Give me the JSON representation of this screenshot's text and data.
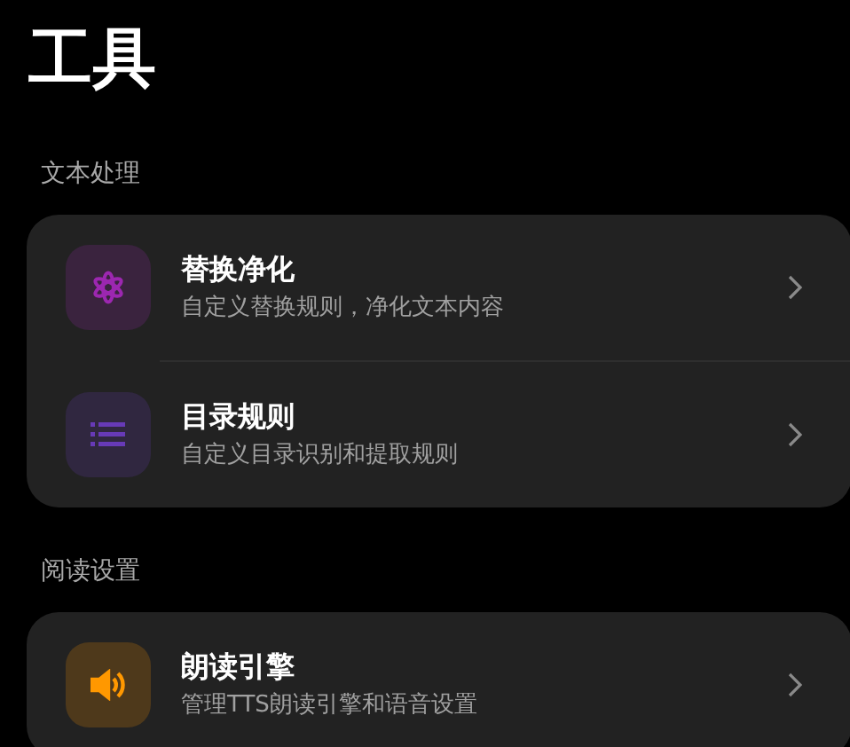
{
  "title": "工具",
  "sections": [
    {
      "label": "文本处理",
      "items": [
        {
          "kind": "flower",
          "color": "#9c27b0",
          "title": "替换净化",
          "subtitle": "自定义替换规则，净化文本内容"
        },
        {
          "kind": "list",
          "color": "#673ab7",
          "title": "目录规则",
          "subtitle": "自定义目录识别和提取规则"
        }
      ]
    },
    {
      "label": "阅读设置",
      "items": [
        {
          "kind": "speaker",
          "color": "#ff9800",
          "title": "朗读引擎",
          "subtitle": "管理TTS朗读引擎和语音设置"
        }
      ]
    }
  ]
}
